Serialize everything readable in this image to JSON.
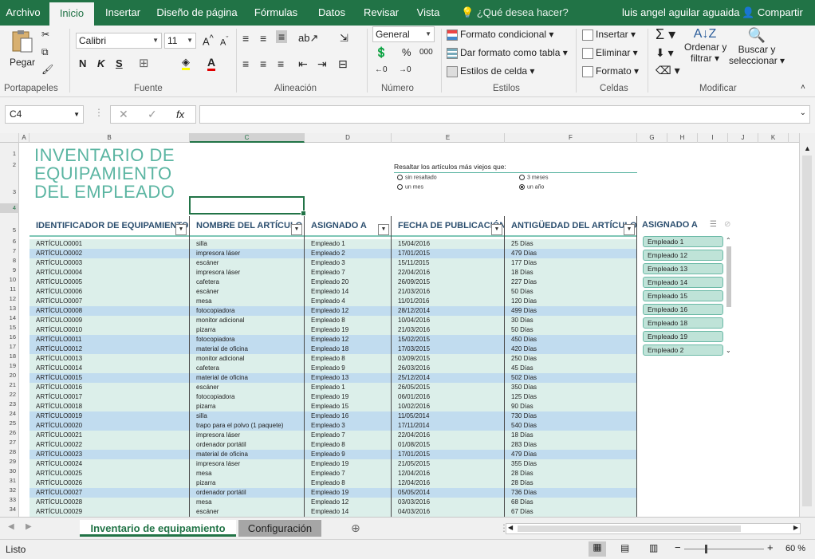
{
  "ribbon_tabs": [
    "Archivo",
    "Inicio",
    "Insertar",
    "Diseño de página",
    "Fórmulas",
    "Datos",
    "Revisar",
    "Vista"
  ],
  "tell_me": "¿Qué desea hacer?",
  "user_name": "luis angel aguilar aguaida",
  "share_label": "Compartir",
  "clipboard": {
    "paste": "Pegar",
    "group": "Portapapeles"
  },
  "font": {
    "name": "Calibri",
    "size": "11",
    "bold": "N",
    "italic": "K",
    "underline": "S",
    "group": "Fuente"
  },
  "alignment": {
    "group": "Alineación"
  },
  "number": {
    "format": "General",
    "percent": "%",
    "thousands": "000",
    "group": "Número"
  },
  "styles": {
    "conditional": "Formato condicional",
    "as_table": "Dar formato como tabla",
    "cell_styles": "Estilos de celda",
    "group": "Estilos"
  },
  "cells": {
    "insert": "Insertar",
    "delete": "Eliminar",
    "format": "Formato",
    "group": "Celdas"
  },
  "editing": {
    "sort": "Ordenar y",
    "sort2": "filtrar",
    "find": "Buscar y",
    "find2": "seleccionar",
    "group": "Modificar"
  },
  "name_box": "C4",
  "columns": [
    "A",
    "B",
    "C",
    "D",
    "E",
    "F",
    "G",
    "H",
    "I",
    "J",
    "K"
  ],
  "rows": [
    "1",
    "2",
    "3",
    "4",
    "5",
    "6",
    "7",
    "8",
    "9",
    "10",
    "11",
    "12",
    "13",
    "14",
    "15",
    "16",
    "17",
    "18",
    "19",
    "20",
    "21",
    "22",
    "23",
    "24",
    "25",
    "26",
    "27",
    "28",
    "29",
    "30",
    "31",
    "32",
    "33",
    "34"
  ],
  "sheet": {
    "title1": "INVENTARIO DE",
    "title2": "EQUIPAMIENTO",
    "title3": "DEL EMPLEADO",
    "highlight_label": "Resaltar los artículos más viejos que:",
    "radio_none": "sin resaltado",
    "radio_3m": "3 meses",
    "radio_1m": "un mes",
    "radio_1y": "un año",
    "headers": [
      "IDENTIFICADOR DE EQUIPAMIENTO",
      "NOMBRE DEL ARTÍCULO",
      "ASIGNADO A",
      "FECHA DE PUBLICACIÓN",
      "ANTIGÜEDAD DEL ARTÍCULO"
    ],
    "rows": [
      [
        "ARTÍCULO0001",
        "silla",
        "Empleado 1",
        "15/04/2016",
        "25 Días"
      ],
      [
        "ARTÍCULO0002",
        "impresora láser",
        "Empleado 2",
        "17/01/2015",
        "479 Días"
      ],
      [
        "ARTÍCULO0003",
        "escáner",
        "Empleado 3",
        "15/11/2015",
        "177 Días"
      ],
      [
        "ARTÍCULO0004",
        "impresora láser",
        "Empleado 7",
        "22/04/2016",
        "18 Días"
      ],
      [
        "ARTÍCULO0005",
        "cafetera",
        "Empleado 20",
        "26/09/2015",
        "227 Días"
      ],
      [
        "ARTÍCULO0006",
        "escáner",
        "Empleado 14",
        "21/03/2016",
        "50 Días"
      ],
      [
        "ARTÍCULO0007",
        "mesa",
        "Empleado 4",
        "11/01/2016",
        "120 Días"
      ],
      [
        "ARTÍCULO0008",
        "fotocopiadora",
        "Empleado 12",
        "28/12/2014",
        "499 Días"
      ],
      [
        "ARTÍCULO0009",
        "monitor adicional",
        "Empleado 8",
        "10/04/2016",
        "30 Días"
      ],
      [
        "ARTÍCULO0010",
        "pizarra",
        "Empleado 19",
        "21/03/2016",
        "50 Días"
      ],
      [
        "ARTÍCULO0011",
        "fotocopiadora",
        "Empleado 12",
        "15/02/2015",
        "450 Días"
      ],
      [
        "ARTÍCULO0012",
        "material de oficina",
        "Empleado 18",
        "17/03/2015",
        "420 Días"
      ],
      [
        "ARTÍCULO0013",
        "monitor adicional",
        "Empleado 8",
        "03/09/2015",
        "250 Días"
      ],
      [
        "ARTÍCULO0014",
        "cafetera",
        "Empleado 9",
        "26/03/2016",
        "45 Días"
      ],
      [
        "ARTÍCULO0015",
        "material de oficina",
        "Empleado 13",
        "25/12/2014",
        "502 Días"
      ],
      [
        "ARTÍCULO0016",
        "escáner",
        "Empleado 1",
        "26/05/2015",
        "350 Días"
      ],
      [
        "ARTÍCULO0017",
        "fotocopiadora",
        "Empleado 19",
        "06/01/2016",
        "125 Días"
      ],
      [
        "ARTÍCULO0018",
        "pizarra",
        "Empleado 15",
        "10/02/2016",
        "90 Días"
      ],
      [
        "ARTÍCULO0019",
        "silla",
        "Empleado 16",
        "11/05/2014",
        "730 Días"
      ],
      [
        "ARTÍCULO0020",
        "trapo para el polvo (1 paquete)",
        "Empleado 3",
        "17/11/2014",
        "540 Días"
      ],
      [
        "ARTÍCULO0021",
        "impresora láser",
        "Empleado 7",
        "22/04/2016",
        "18 Días"
      ],
      [
        "ARTÍCULO0022",
        "ordenador portátil",
        "Empleado 8",
        "01/08/2015",
        "283 Días"
      ],
      [
        "ARTÍCULO0023",
        "material de oficina",
        "Empleado 9",
        "17/01/2015",
        "479 Días"
      ],
      [
        "ARTÍCULO0024",
        "impresora láser",
        "Empleado 19",
        "21/05/2015",
        "355 Días"
      ],
      [
        "ARTÍCULO0025",
        "mesa",
        "Empleado 7",
        "12/04/2016",
        "28 Días"
      ],
      [
        "ARTÍCULO0026",
        "pizarra",
        "Empleado 8",
        "12/04/2016",
        "28 Días"
      ],
      [
        "ARTÍCULO0027",
        "ordenador portátil",
        "Empleado 19",
        "05/05/2014",
        "736 Días"
      ],
      [
        "ARTÍCULO0028",
        "mesa",
        "Empleado 12",
        "03/03/2016",
        "68 Días"
      ],
      [
        "ARTÍCULO0029",
        "escáner",
        "Empleado 14",
        "04/03/2016",
        "67 Días"
      ]
    ],
    "highlighted_rows": [
      1,
      7,
      10,
      11,
      14,
      18,
      19,
      22,
      26
    ],
    "slicer_title": "ASIGNADO A",
    "slicer_items": [
      "Empleado 1",
      "Empleado 12",
      "Empleado 13",
      "Empleado 14",
      "Empleado 15",
      "Empleado 16",
      "Empleado 18",
      "Empleado 19",
      "Empleado 2"
    ]
  },
  "sheet_tabs": [
    "Inventario de equipamiento",
    "Configuración"
  ],
  "status": {
    "ready": "Listo",
    "zoom": "60 %"
  },
  "colors": {
    "accent": "#217346",
    "title": "#5bb5a2",
    "header_text": "#2b4e6e",
    "row_light": "#dcefea",
    "row_blue": "#c1dcef"
  }
}
